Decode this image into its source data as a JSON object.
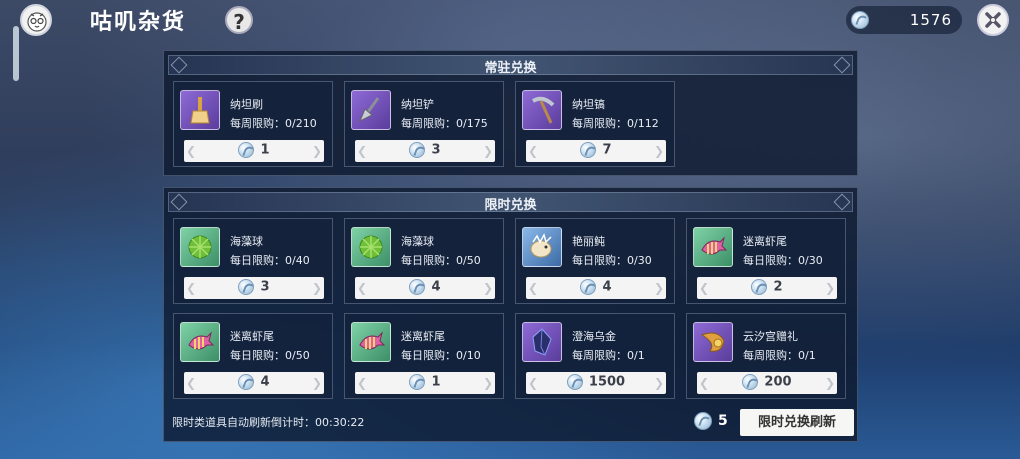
{
  "header": {
    "title": "咕叽杂货",
    "help_label": "?",
    "currency_amount": "1576"
  },
  "permanent": {
    "title": "常驻兑换",
    "items": [
      {
        "name": "纳坦刷",
        "limit": "每周限购：0/210",
        "price": "1",
        "icon": "brush-icon",
        "color": "purple"
      },
      {
        "name": "纳坦铲",
        "limit": "每周限购：0/175",
        "price": "3",
        "icon": "shovel-icon",
        "color": "purple"
      },
      {
        "name": "纳坦镐",
        "limit": "每周限购：0/112",
        "price": "7",
        "icon": "pickaxe-icon",
        "color": "purple"
      }
    ]
  },
  "limited": {
    "title": "限时兑换",
    "items": [
      {
        "name": "海藻球",
        "limit": "每日限购：0/40",
        "price": "3",
        "icon": "seaweed-ball-icon",
        "color": "green"
      },
      {
        "name": "海藻球",
        "limit": "每日限购：0/50",
        "price": "4",
        "icon": "seaweed-ball-icon",
        "color": "green"
      },
      {
        "name": "艳丽鲀",
        "limit": "每日限购：0/30",
        "price": "4",
        "icon": "puffer-fish-icon",
        "color": "blue"
      },
      {
        "name": "迷离虾尾",
        "limit": "每日限购：0/30",
        "price": "2",
        "icon": "shrimp-tail-icon",
        "color": "green"
      },
      {
        "name": "迷离虾尾",
        "limit": "每日限购：0/50",
        "price": "4",
        "icon": "shrimp-tail-icon",
        "color": "green"
      },
      {
        "name": "迷离虾尾",
        "limit": "每日限购：0/10",
        "price": "1",
        "icon": "shrimp-tail-icon",
        "color": "green"
      },
      {
        "name": "澄海乌金",
        "limit": "每周限购：0/1",
        "price": "1500",
        "icon": "dark-crystal-icon",
        "color": "purple"
      },
      {
        "name": "云汐宫赠礼",
        "limit": "每周限购：0/1",
        "price": "200",
        "icon": "cornucopia-icon",
        "color": "purple"
      }
    ]
  },
  "footer": {
    "countdown_text": "限时类道具自动刷新倒计时：00:30:22",
    "refresh_cost": "5",
    "refresh_label": "限时兑换刷新"
  }
}
